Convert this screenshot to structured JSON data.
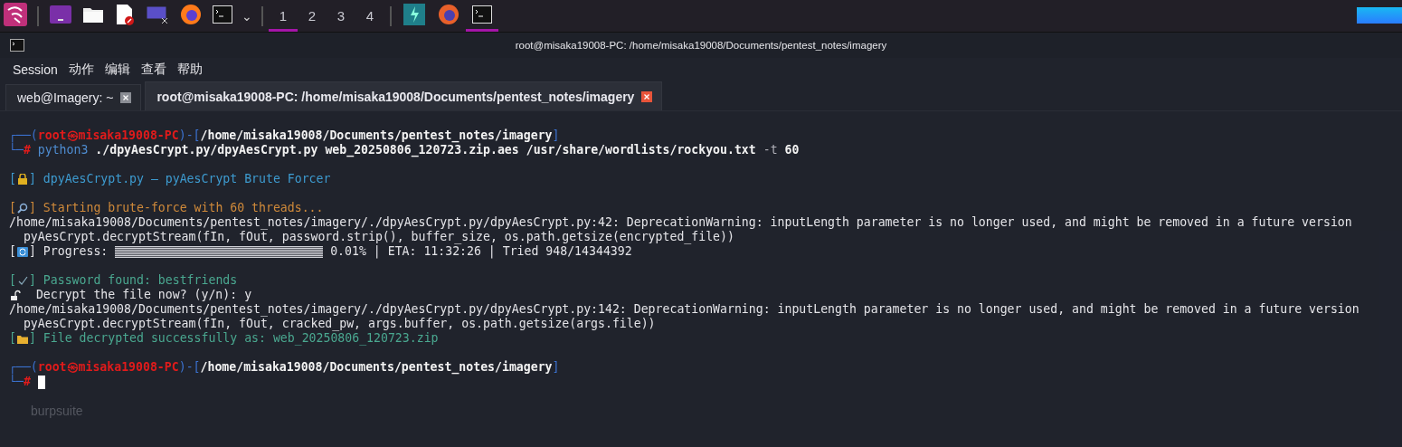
{
  "taskbar": {
    "launchers": [
      {
        "kind": "kali",
        "active": false
      },
      {
        "kind": "panel",
        "active": false
      },
      {
        "kind": "folder",
        "active": false
      },
      {
        "kind": "editor",
        "active": false
      },
      {
        "kind": "screen",
        "active": false
      },
      {
        "kind": "firefox",
        "active": false
      },
      {
        "kind": "terminal",
        "active": false
      }
    ],
    "dropdown": "⌄",
    "workspaces": [
      {
        "label": "1",
        "selected": true
      },
      {
        "label": "2",
        "selected": false
      },
      {
        "label": "3",
        "selected": false
      },
      {
        "label": "4",
        "selected": false
      }
    ],
    "tasks": [
      {
        "kind": "burp",
        "active": false
      },
      {
        "kind": "firefox",
        "active": false
      },
      {
        "kind": "terminal",
        "active": true
      }
    ]
  },
  "window": {
    "title": "root@misaka19008-PC: /home/misaka19008/Documents/pentest_notes/imagery"
  },
  "menu": [
    "Session",
    "动作",
    "编辑",
    "查看",
    "帮助"
  ],
  "tabs": [
    {
      "label": "web@Imagery: ~",
      "selected": false
    },
    {
      "label": "root@misaka19008-PC: /home/misaka19008/Documents/pentest_notes/imagery",
      "selected": true
    }
  ],
  "terminal": {
    "blocks": [
      [
        [
          {
            "kind": "frame",
            "text": "┌──("
          },
          {
            "kind": "user",
            "text": "root㉿misaka19008-PC"
          },
          {
            "kind": "frame",
            "text": ")-["
          },
          {
            "kind": "path",
            "text": "/home/misaka19008/Documents/pentest_notes/imagery"
          },
          {
            "kind": "frame",
            "text": "]"
          }
        ],
        [
          {
            "kind": "frame",
            "text": "└─"
          },
          {
            "kind": "hash",
            "text": "#"
          },
          {
            "kind": "cmd",
            "text": " python3"
          },
          {
            "kind": "arg",
            "text": " ./dpyAesCrypt.py/dpyAesCrypt.py web_20250806_120723.zip.aes /usr/share/wordlists/rockyou.txt"
          },
          {
            "kind": "flag",
            "text": " -t"
          },
          {
            "kind": "arg",
            "text": " 60"
          }
        ]
      ],
      [
        [
          {
            "kind": "info",
            "text": "["
          },
          {
            "kind": "icon-lock"
          },
          {
            "kind": "info",
            "text": "] dpyAesCrypt.py – pyAesCrypt Brute Forcer"
          }
        ]
      ],
      [
        [
          {
            "kind": "warn",
            "text": "["
          },
          {
            "kind": "icon-search"
          },
          {
            "kind": "warn",
            "text": "] Starting brute-force with 60 threads..."
          }
        ],
        [
          {
            "kind": "plain",
            "text": "/home/misaka19008/Documents/pentest_notes/imagery/./dpyAesCrypt.py/dpyAesCrypt.py:42: DeprecationWarning: inputLength parameter is no longer used, and might be removed in a future version"
          }
        ],
        [
          {
            "kind": "plain",
            "text": "  pyAesCrypt.decryptStream(fIn, fOut, password.strip(), buffer_size, os.path.getsize(encrypted_file))"
          }
        ],
        [
          {
            "kind": "plain",
            "text": "["
          },
          {
            "kind": "icon-refresh"
          },
          {
            "kind": "plain",
            "text": "] Progress: "
          },
          {
            "kind": "bar",
            "level": 0.0001
          },
          {
            "kind": "plain",
            "text": " 0.01% | ETA: 11:32:26 | Tried 948/14344392"
          }
        ]
      ],
      [
        [
          {
            "kind": "success",
            "text": "["
          },
          {
            "kind": "icon-check"
          },
          {
            "kind": "success",
            "text": "] Password found: bestfriends"
          }
        ],
        [
          {
            "kind": "icon-unlock"
          },
          {
            "kind": "plain",
            "text": "  Decrypt the file now? (y/n): y"
          }
        ],
        [
          {
            "kind": "plain",
            "text": "/home/misaka19008/Documents/pentest_notes/imagery/./dpyAesCrypt.py/dpyAesCrypt.py:142: DeprecationWarning: inputLength parameter is no longer used, and might be removed in a future version"
          }
        ],
        [
          {
            "kind": "plain",
            "text": "  pyAesCrypt.decryptStream(fIn, fOut, cracked_pw, args.buffer, os.path.getsize(args.file))"
          }
        ],
        [
          {
            "kind": "success",
            "text": "["
          },
          {
            "kind": "icon-folder"
          },
          {
            "kind": "success",
            "text": "] File decrypted successfully as: web_20250806_120723.zip"
          }
        ]
      ],
      [
        [
          {
            "kind": "frame",
            "text": "┌──("
          },
          {
            "kind": "user",
            "text": "root㉿misaka19008-PC"
          },
          {
            "kind": "frame",
            "text": ")-["
          },
          {
            "kind": "path",
            "text": "/home/misaka19008/Documents/pentest_notes/imagery"
          },
          {
            "kind": "frame",
            "text": "]"
          }
        ],
        [
          {
            "kind": "frame",
            "text": "└─"
          },
          {
            "kind": "hash",
            "text": "#"
          },
          {
            "kind": "cursor"
          }
        ]
      ]
    ]
  },
  "desktop_label": "burpsuite"
}
